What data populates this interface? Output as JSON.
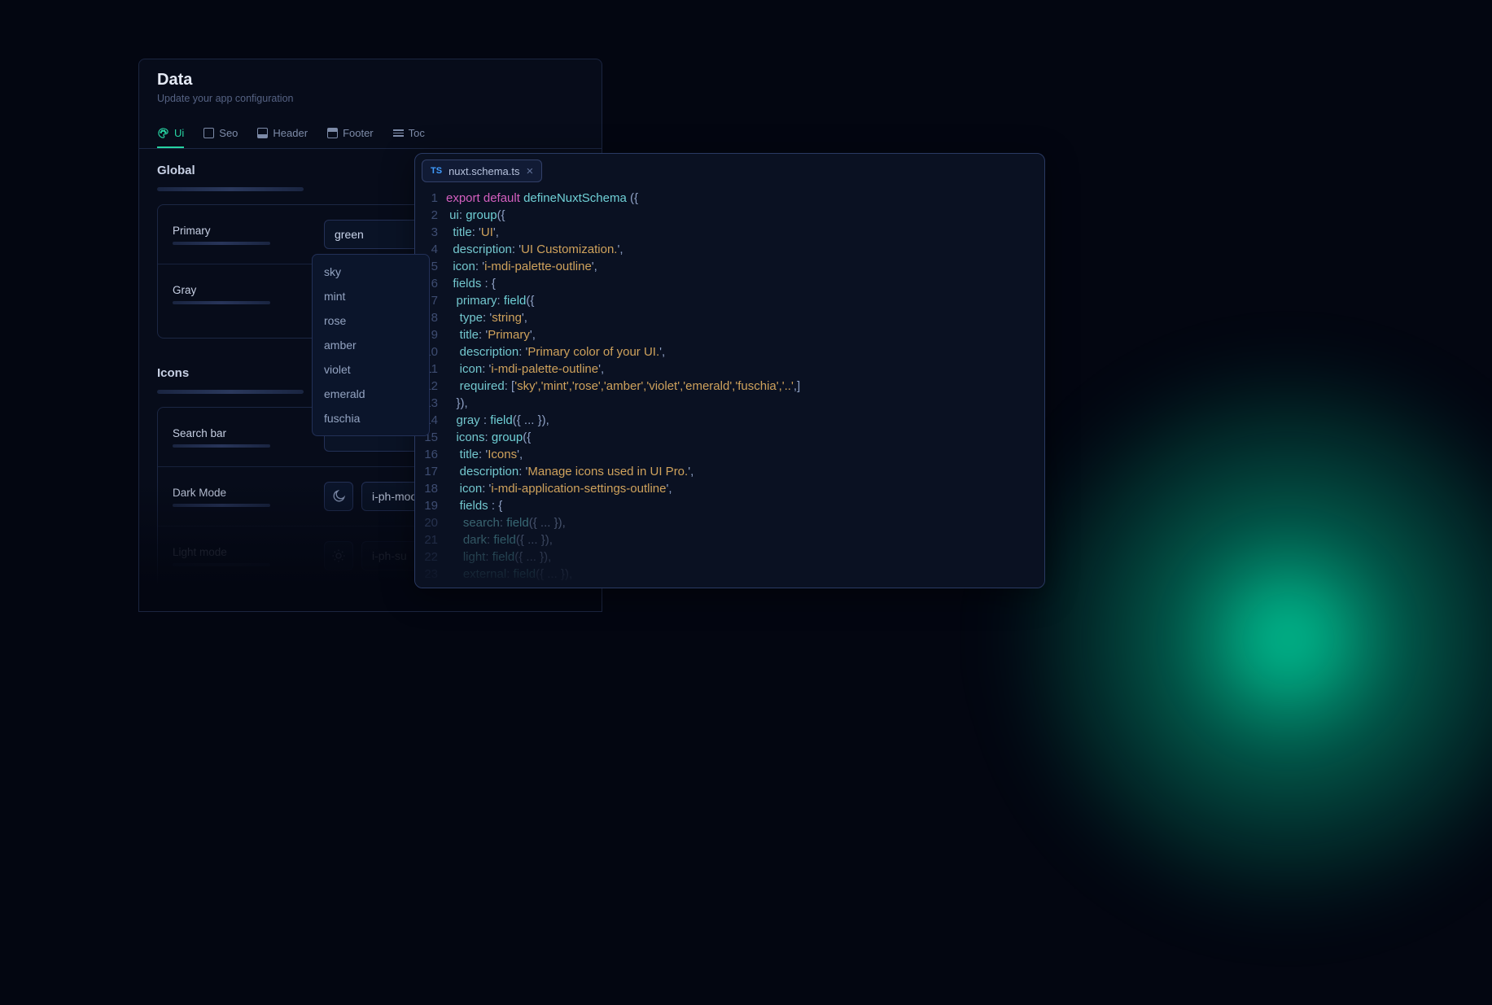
{
  "panel": {
    "title": "Data",
    "subtitle": "Update your app configuration"
  },
  "tabs": [
    {
      "id": "ui",
      "label": "Ui",
      "active": true
    },
    {
      "id": "seo",
      "label": "Seo",
      "active": false
    },
    {
      "id": "header",
      "label": "Header",
      "active": false
    },
    {
      "id": "footer",
      "label": "Footer",
      "active": false
    },
    {
      "id": "toc",
      "label": "Toc",
      "active": false
    }
  ],
  "sections": {
    "global": "Global",
    "icons": "Icons"
  },
  "fields": {
    "primary": {
      "label": "Primary",
      "value": "green"
    },
    "gray": {
      "label": "Gray",
      "value": ""
    },
    "searchbar": {
      "label": "Search bar",
      "value": ""
    },
    "dark": {
      "label": "Dark Mode",
      "value": "i-ph-moo"
    },
    "light": {
      "label": "Light mode",
      "value": "i-ph-su"
    }
  },
  "primary_options": [
    "sky",
    "mint",
    "rose",
    "amber",
    "violet",
    "emerald",
    "fuschia"
  ],
  "editor": {
    "filename": "nuxt.schema.ts",
    "filetype": "TS"
  },
  "schema_source": {
    "ui_group": {
      "title": "UI",
      "description": "UI Customization.",
      "icon": "i-mdi-palette-outline",
      "fields": {
        "primary": {
          "type": "string",
          "title": "Primary",
          "description": "Primary color of your UI.",
          "icon": "i-mdi-palette-outline",
          "required": [
            "sky",
            "mint",
            "rose",
            "amber",
            "violet",
            "emerald",
            "fuschia",
            ".."
          ]
        },
        "gray": {
          "collapsed": true
        },
        "icons_group": {
          "title": "Icons",
          "description": "Manage icons used in UI Pro.",
          "icon": "i-mdi-application-settings-outline",
          "fields": {
            "search": {
              "collapsed": true
            },
            "dark": {
              "collapsed": true
            },
            "light": {
              "collapsed": true
            },
            "external": {
              "collapsed": true
            }
          }
        }
      }
    }
  }
}
